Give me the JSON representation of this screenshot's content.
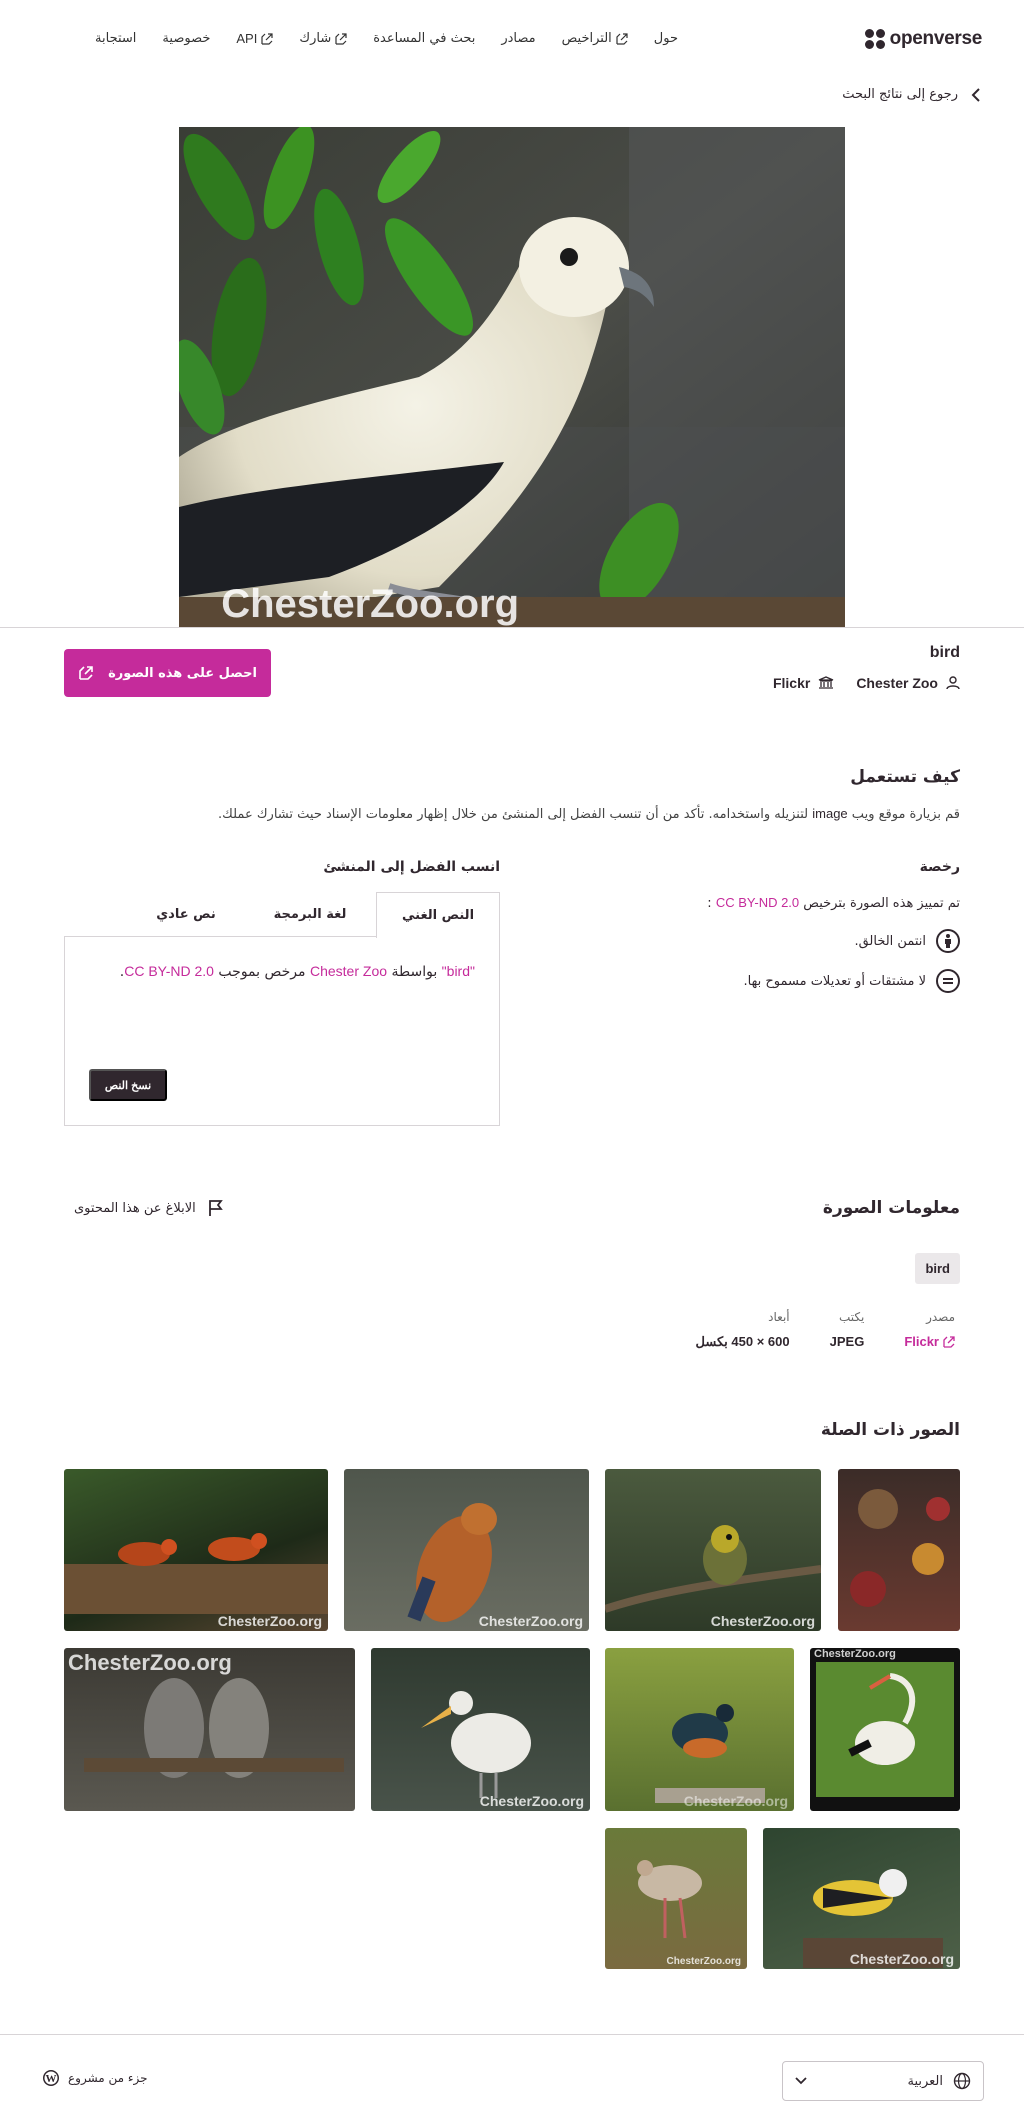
{
  "header": {
    "logo_text": "openverse",
    "nav": [
      {
        "label": "حول",
        "external": false
      },
      {
        "label": "التراخيص",
        "external": true
      },
      {
        "label": "مصادر",
        "external": false
      },
      {
        "label": "بحث في المساعدة",
        "external": false
      },
      {
        "label": "شارك",
        "external": true
      },
      {
        "label": "API",
        "external": true
      },
      {
        "label": "خصوصية",
        "external": false
      },
      {
        "label": "استجابة",
        "external": false
      }
    ]
  },
  "back_link": "رجوع إلى نتائج البحث",
  "image": {
    "watermark": "ChesterZoo.org",
    "title": "bird",
    "creator": "Chester Zoo",
    "source": "Flickr",
    "get_button": "احصل على هذه الصورة"
  },
  "how_to_use": {
    "heading": "كيف تستعمل",
    "text_before": "قم بزيارة موقع ويب ",
    "text_keyword": "image",
    "text_after": " لتنزيله واستخدامه. تأكد من أن تنسب الفضل إلى المنشئ من خلال إظهار معلومات الإسناد حيث تشارك عملك."
  },
  "license": {
    "heading": "رخصة",
    "intro": "تم تمييز هذه الصورة بترخيص",
    "name": "CC BY-ND 2.0",
    "suffix": ":",
    "conditions": [
      {
        "icon": "BY",
        "text": "انتمن الخالق."
      },
      {
        "icon": "=",
        "text": "لا مشتقات أو تعديلات مسموح بها."
      }
    ]
  },
  "attribution": {
    "heading": "انسب الفضل إلى المنشئ",
    "tabs": [
      "النص الغني",
      "لغة البرمجة",
      "نص عادي"
    ],
    "active_tab": 0,
    "title_quoted": "\"bird\"",
    "by": " بواسطة ",
    "creator": "Chester Zoo",
    "licensed": " مرخص بموجب ",
    "license": "CC BY-ND 2.0",
    "period": ".",
    "copy_button": "نسخ النص"
  },
  "info": {
    "heading": "معلومات الصورة",
    "report": "الابلاغ عن هذا المحتوى",
    "tags": [
      "bird"
    ],
    "meta": [
      {
        "label": "مصدر",
        "value": "Flickr",
        "link": true
      },
      {
        "label": "يكتب",
        "value": "JPEG",
        "link": false
      },
      {
        "label": "أبعاد",
        "value": "600 × 450 بكسل",
        "link": false
      }
    ]
  },
  "related": {
    "heading": "الصور ذات الصلة",
    "watermarks": [
      "ChesterZoo.org",
      "ChesterZoo.org",
      "ChesterZoo.org",
      "ChesterZoo.org",
      "ChesterZoo.org",
      "ChesterZoo.org",
      "ChesterZoo.org",
      "ChesterZoo.org",
      "ChesterZoo.org",
      "ChesterZoo.org"
    ]
  },
  "footer": {
    "language": "العربية",
    "project": "جزء من مشروع"
  },
  "colors": {
    "accent": "#c52b9b",
    "text": "#30272e",
    "border": "#d8d4d7"
  }
}
